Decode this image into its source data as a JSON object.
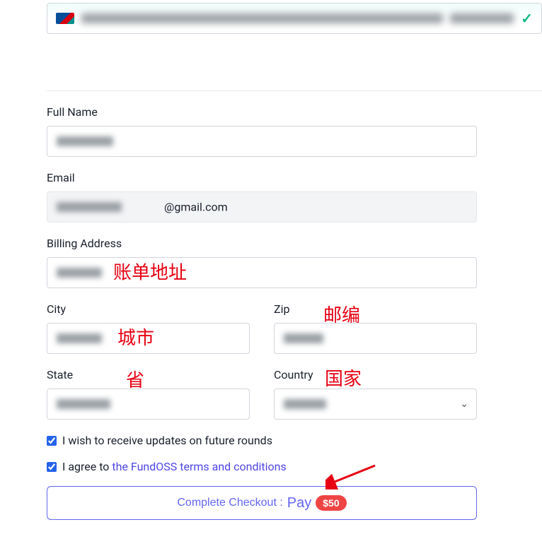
{
  "card": {
    "checkIcon": "✓"
  },
  "form": {
    "fullNameLabel": "Full Name",
    "emailLabel": "Email",
    "emailSuffix": "@gmail.com",
    "billingAddressLabel": "Billing Address",
    "cityLabel": "City",
    "zipLabel": "Zip",
    "stateLabel": "State",
    "countryLabel": "Country"
  },
  "annotations": {
    "billingAddress": "账单地址",
    "city": "城市",
    "zip": "邮编",
    "state": "省",
    "country": "国家"
  },
  "checkboxes": {
    "updates": "I wish to receive updates on future rounds",
    "agreePrefix": "I agree to ",
    "agreeLink": "the FundOSS terms and conditions"
  },
  "checkout": {
    "complete": "Complete Checkout :",
    "pay": "Pay",
    "amount": "$50"
  }
}
